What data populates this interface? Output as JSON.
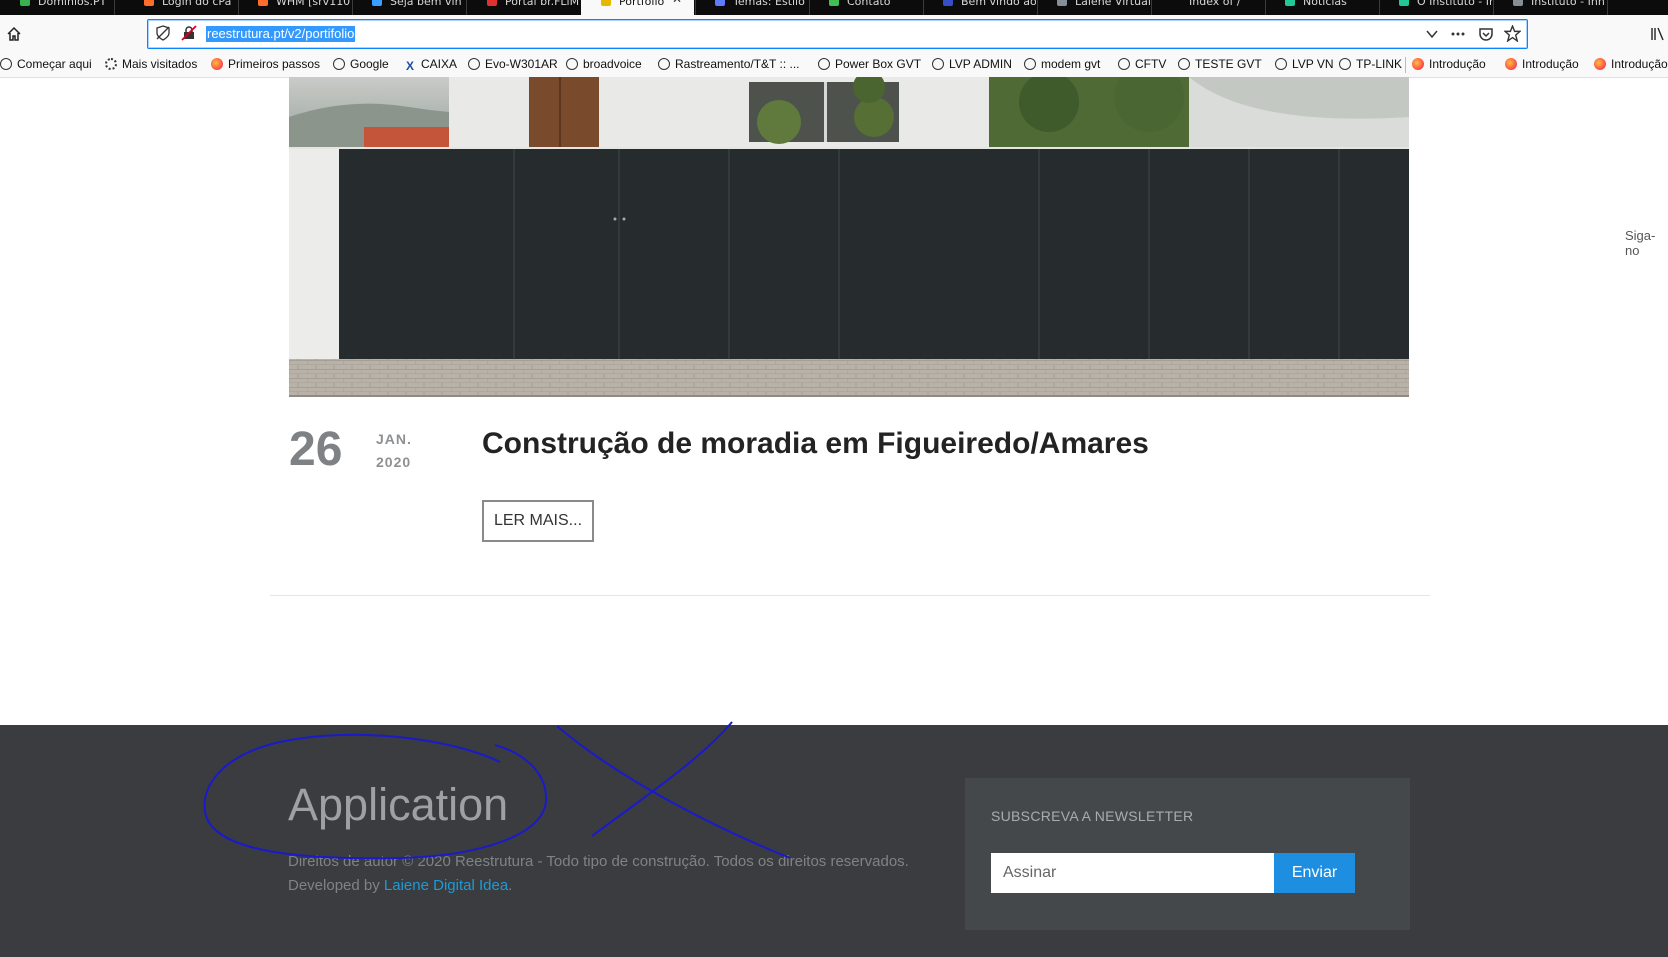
{
  "browser": {
    "tabs": [
      {
        "label": "Domínios.PT",
        "color": "#37b24d"
      },
      {
        "label": "Login do cPa",
        "color": "#ff6c2c"
      },
      {
        "label": "WHM [srv110",
        "color": "#ff6c2c"
      },
      {
        "label": "Seja bem vin",
        "color": "#3aa0ff"
      },
      {
        "label": "Portal br.FLiM",
        "color": "#e03131"
      },
      {
        "label": "Portfólio",
        "color": "#e6b800",
        "active": true
      },
      {
        "label": "Temas: Estilo",
        "color": "#5c7cfa"
      },
      {
        "label": "Contato",
        "color": "#40c057"
      },
      {
        "label": "Bem vindo ao",
        "color": "#364fc7"
      },
      {
        "label": "Laiene Virtual",
        "color": "#868e96"
      },
      {
        "label": "Index of /",
        "color": "#0c0c0d"
      },
      {
        "label": "Notícias",
        "color": "#20c997"
      },
      {
        "label": "O Instituto - In",
        "color": "#20c997"
      },
      {
        "label": "Instituto - Inn",
        "color": "#868e96"
      }
    ],
    "url": "reestrutura.pt/v2/portifolio",
    "bookmarks": [
      {
        "label": "Começar aqui",
        "icon": "globe-icon"
      },
      {
        "label": "Mais visitados",
        "icon": "gear-icon"
      },
      {
        "label": "Primeiros passos",
        "icon": "firefox-icon"
      },
      {
        "label": "Google",
        "icon": "globe-icon"
      },
      {
        "label": "CAIXA",
        "icon": "caixa-icon"
      },
      {
        "label": "Evo-W301AR",
        "icon": "globe-icon"
      },
      {
        "label": "broadvoice",
        "icon": "globe-icon"
      },
      {
        "label": "Rastreamento/T&T :: ...",
        "icon": "globe-icon"
      },
      {
        "label": "Power Box GVT",
        "icon": "globe-icon"
      },
      {
        "label": "LVP ADMIN",
        "icon": "globe-icon"
      },
      {
        "label": "modem gvt",
        "icon": "globe-icon"
      },
      {
        "label": "CFTV",
        "icon": "globe-icon"
      },
      {
        "label": "TESTE GVT",
        "icon": "globe-icon"
      },
      {
        "label": "LVP VN",
        "icon": "globe-icon"
      },
      {
        "label": "TP-LINK",
        "icon": "globe-icon"
      },
      {
        "label": "Introdução",
        "icon": "firefox-icon"
      },
      {
        "label": "Introdução",
        "icon": "firefox-icon"
      },
      {
        "label": "Introdução",
        "icon": "firefox-icon"
      }
    ]
  },
  "post": {
    "day": "26",
    "month": "JAN.",
    "year": "2020",
    "title": "Construção de moradia em Figueiredo/Amares",
    "read_more": "LER MAIS..."
  },
  "side_text": "Siga-no",
  "footer": {
    "app_title": "Application",
    "copyright": "Direitos de autor © 2020 Reestrutura - Todo tipo de construção. Todos os direitos reservados.",
    "developed_by": "Developed by",
    "developer": "Laiene Digital Idea",
    "newsletter_title": "SUBSCREVA A NEWSLETTER",
    "newsletter_placeholder": "Assinar",
    "newsletter_button": "Enviar"
  },
  "colors": {
    "accent": "#1e8fe0",
    "footer_bg": "#3a3c3f",
    "annotation": "#1a1acc"
  }
}
